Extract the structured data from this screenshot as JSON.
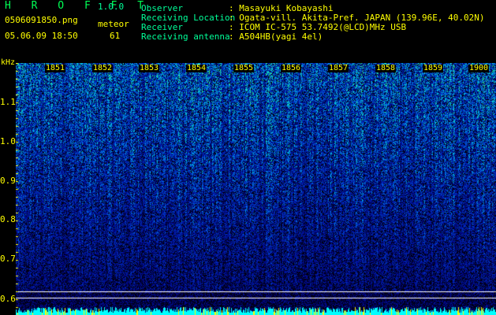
{
  "header": {
    "app_title": "H R O F F T",
    "version": "1.0.0",
    "filename": "0506091850.png",
    "datetime": "05.06.09 18:50",
    "meteor_label": "meteor",
    "meteor_count": "61"
  },
  "info": {
    "observer_label": "Observer",
    "observer_value": ": Masayuki Kobayashi",
    "location_label": "Receiving Location",
    "location_value": ": Ogata-vill. Akita-Pref. JAPAN (139.96E, 40.02N)",
    "receiver_label": "Receiver",
    "receiver_value": ": ICOM IC-575 53.7492(@LCD)MHz USB",
    "antenna_label": "Receiving antenna",
    "antenna_value": ": A504HB(yagi 4el)"
  },
  "y_axis": {
    "unit": "kHz",
    "ticks": [
      "1.1",
      "1.0",
      "0.9",
      "0.8",
      "0.7",
      "0.6"
    ]
  },
  "x_axis": {
    "ticks": [
      "1851",
      "1852",
      "1853",
      "1854",
      "1855",
      "1856",
      "1857",
      "1858",
      "1859",
      "1900"
    ]
  },
  "colors": {
    "background": "#000000",
    "label_green": "#00ff99",
    "text_yellow": "#ffff00",
    "spectrum_low": "#001a80",
    "spectrum_high": "#00ffcc"
  }
}
